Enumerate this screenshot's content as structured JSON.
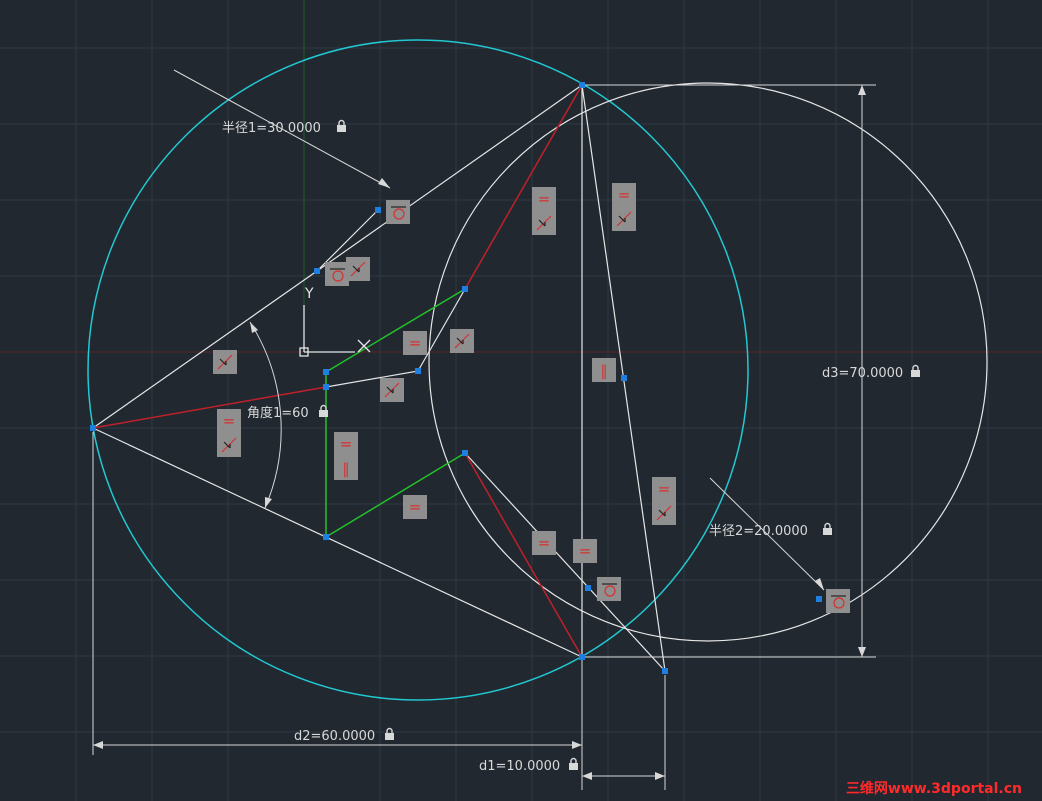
{
  "dimensions": {
    "radius1": "半径1=30.0000",
    "radius2": "半径2=20.0000",
    "angle1": "角度1=60",
    "d1": "d1=10.0000",
    "d2": "d2=60.0000",
    "d3": "d3=70.0000"
  },
  "ucs": {
    "y_label": "Y"
  },
  "constraint_icons": {
    "equal": "=",
    "parallel": "∥",
    "perpendicular": "⊥",
    "tangent": "tangent-icon",
    "coincident": "coincident-icon"
  },
  "watermark": "三维网www.3dportal.cn",
  "colors": {
    "background": "#212830",
    "cyan_circle": "#22c8d2",
    "red_line": "#c0202a",
    "green_line": "#22c22a",
    "white_line": "#e6e6e6",
    "grip": "#1e7fe0",
    "constraint_box": "#8f8f8f",
    "constraint_mark": "#d83030"
  }
}
